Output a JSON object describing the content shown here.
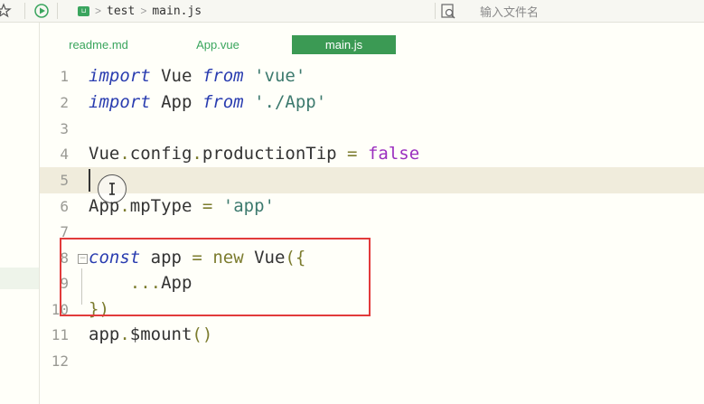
{
  "toolbar": {
    "icons": [
      "star-icon",
      "run-icon",
      "folder-icon",
      "search-file-icon"
    ],
    "breadcrumb": [
      "test",
      "main.js"
    ],
    "search_placeholder": "输入文件名"
  },
  "tabs": [
    {
      "label": "readme.md",
      "active": false
    },
    {
      "label": "App.vue",
      "active": false
    },
    {
      "label": "main.js",
      "active": true
    }
  ],
  "editor": {
    "line_numbers": [
      "1",
      "2",
      "3",
      "4",
      "5",
      "6",
      "7",
      "8",
      "9",
      "10",
      "11",
      "12"
    ],
    "current_line": "5",
    "code": {
      "l1": {
        "kw": "import",
        "a": " Vue ",
        "from": "from",
        "b": " ",
        "str": "'vue'"
      },
      "l2": {
        "kw": "import",
        "a": " App ",
        "from": "from",
        "b": " ",
        "str": "'./App'"
      },
      "l4": {
        "a": "Vue",
        "op1": ".",
        "b": "config",
        "op2": ".",
        "c": "productionTip ",
        "op3": "=",
        "d": " ",
        "bool": "false"
      },
      "l6": {
        "a": "App",
        "op1": ".",
        "b": "mpType ",
        "op2": "=",
        "c": " ",
        "str": "'app'"
      },
      "l8": {
        "kw": "const",
        "a": " app ",
        "op": "=",
        "b": " ",
        "new": "new",
        "c": " Vue",
        "paren": "({"
      },
      "l9": {
        "a": "    ",
        "op": "...",
        "b": "App"
      },
      "l10": {
        "paren": "})"
      },
      "l11": {
        "a": "app",
        "op": ".",
        "b": "$mount",
        "paren": "()"
      }
    }
  },
  "colors": {
    "accent": "#3b9a54",
    "highlight_box": "#e23b3b"
  }
}
